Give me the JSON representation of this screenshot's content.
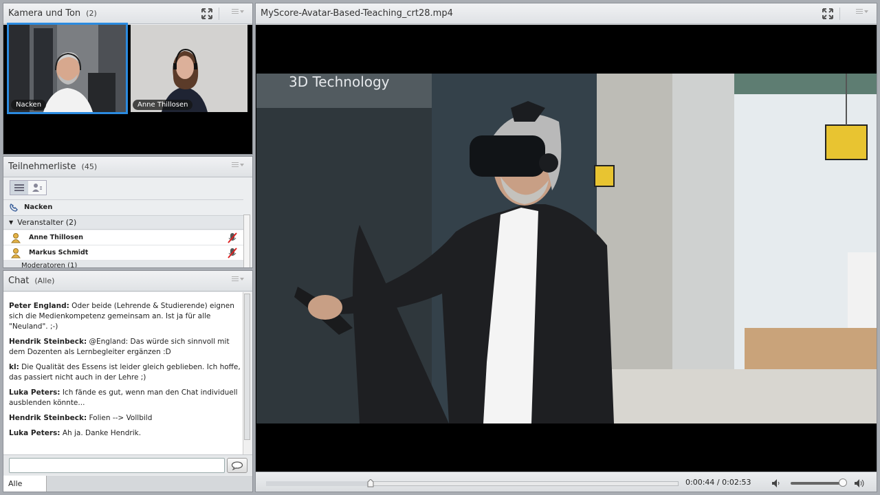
{
  "camera_pod": {
    "title": "Kamera und Ton",
    "count": "(2)",
    "tiles": [
      {
        "name": "Nacken",
        "active": true
      },
      {
        "name": "Anne Thillosen",
        "active": false
      }
    ]
  },
  "participants_pod": {
    "title": "Teilnehmerliste",
    "count": "(45)",
    "me": "Nacken",
    "groups": [
      {
        "label": "Veranstalter (2)",
        "members": [
          {
            "name": "Anne Thillosen"
          },
          {
            "name": "Markus Schmidt"
          }
        ]
      }
    ],
    "cut_group": "Moderatoren (1)"
  },
  "chat_pod": {
    "title": "Chat",
    "scope": "(Alle)",
    "messages": [
      {
        "sender": "Peter England:",
        "text": " Oder beide (Lehrende & Studierende) eignen sich die Medienkompetenz gemeinsam an. Ist ja für alle \"Neuland\". ;-)"
      },
      {
        "sender": "Hendrik Steinbeck:",
        "text": " @England: Das würde sich sinnvoll mit dem Dozenten als Lernbegleiter ergänzen :D"
      },
      {
        "sender": "kl:",
        "text": " Die Qualität des Essens ist leider gleich geblieben. Ich hoffe, das passiert nicht auch in der Lehre ;)"
      },
      {
        "sender": "Luka Peters:",
        "text": " Ich fände es gut, wenn man den Chat individuell ausblenden könnte..."
      },
      {
        "sender": "Hendrik Steinbeck:",
        "text": " Folien --> Vollbild"
      },
      {
        "sender": "Luka Peters:",
        "text": " Ah ja. Danke Hendrik."
      }
    ],
    "input_placeholder": "",
    "target": "Alle"
  },
  "video_pod": {
    "title": "MyScore-Avatar-Based-Teaching_crt28.mp4",
    "frame_caption": "3D Technology",
    "current_time": "0:00:44",
    "separator": "/",
    "total_time": "0:02:53",
    "progress_fraction": 0.254,
    "volume_fraction": 0.95
  },
  "colors": {
    "active_camera_outline": "#2b8be0",
    "pod_background": "#eceef0",
    "app_background": "#a9adb3"
  }
}
